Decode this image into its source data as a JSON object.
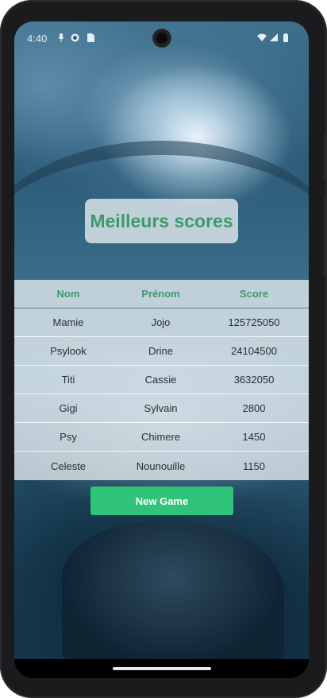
{
  "status_bar": {
    "time": "4:40",
    "icons": [
      "mic-icon",
      "shield-icon",
      "sim-card-icon",
      "wifi-icon",
      "signal-icon",
      "battery-icon"
    ]
  },
  "header": {
    "title": "Meilleurs scores"
  },
  "scores_table": {
    "columns": [
      "Nom",
      "Prénom",
      "Score"
    ],
    "rows": [
      [
        "Mamie",
        "Jojo",
        "125725050"
      ],
      [
        "Psylook",
        "Drine",
        "24104500"
      ],
      [
        "Titi",
        "Cassie",
        "3632050"
      ],
      [
        "Gigi",
        "Sylvain",
        "2800"
      ],
      [
        "Psy",
        "Chimere",
        "1450"
      ],
      [
        "Celeste",
        "Nounouille",
        "1150"
      ]
    ]
  },
  "actions": {
    "new_game_label": "New Game"
  },
  "colors": {
    "accent_green": "#3c9a6c",
    "button_green": "#2fc47a"
  }
}
